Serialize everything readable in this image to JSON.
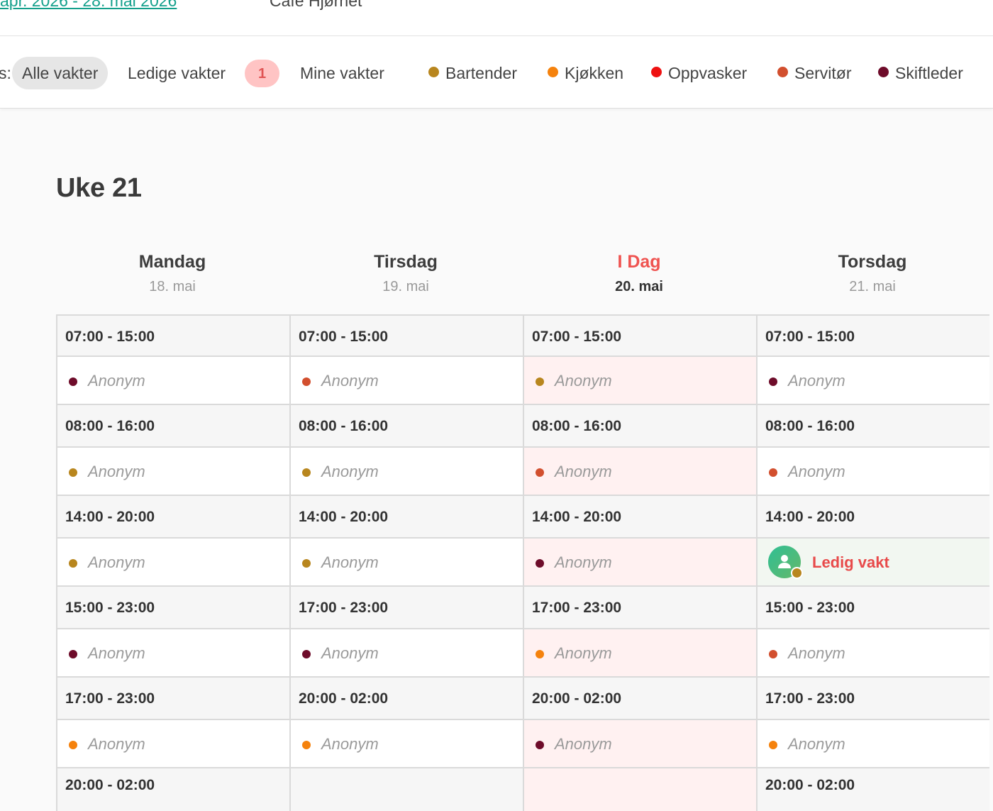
{
  "header": {
    "period_link": "apr. 2026 - 28. mai 2026",
    "location": "Café Hjørnet"
  },
  "filters": {
    "prefix": "s:",
    "tabs": [
      {
        "label": "Alle vakter",
        "active": true
      },
      {
        "label": "Ledige vakter",
        "badge": "1"
      },
      {
        "label": "Mine vakter"
      }
    ],
    "roles": [
      {
        "label": "Bartender",
        "color": "#b8861e"
      },
      {
        "label": "Kjøkken",
        "color": "#f5820d"
      },
      {
        "label": "Oppvasker",
        "color": "#ee1111"
      },
      {
        "label": "Servitør",
        "color": "#d24f2e"
      },
      {
        "label": "Skiftleder",
        "color": "#6e0c2a"
      }
    ]
  },
  "week": {
    "title": "Uke 21",
    "days": [
      {
        "name": "Mandag",
        "date": "18. mai",
        "today": false
      },
      {
        "name": "Tirsdag",
        "date": "19. mai",
        "today": false
      },
      {
        "name": "I Dag",
        "date": "20. mai",
        "today": true
      },
      {
        "name": "Torsdag",
        "date": "21. mai",
        "today": false
      }
    ]
  },
  "shifts": [
    [
      {
        "time": "07:00 - 15:00",
        "employee": "Anonym",
        "role_color": "#6e0c2a"
      },
      {
        "time": "08:00 - 16:00",
        "employee": "Anonym",
        "role_color": "#b8861e"
      },
      {
        "time": "14:00 - 20:00",
        "employee": "Anonym",
        "role_color": "#b8861e"
      },
      {
        "time": "15:00 - 23:00",
        "employee": "Anonym",
        "role_color": "#6e0c2a"
      },
      {
        "time": "17:00 - 23:00",
        "employee": "Anonym",
        "role_color": "#f5820d"
      },
      {
        "time": "20:00 - 02:00"
      }
    ],
    [
      {
        "time": "07:00 - 15:00",
        "employee": "Anonym",
        "role_color": "#d24f2e"
      },
      {
        "time": "08:00 - 16:00",
        "employee": "Anonym",
        "role_color": "#b8861e"
      },
      {
        "time": "14:00 - 20:00",
        "employee": "Anonym",
        "role_color": "#b8861e"
      },
      {
        "time": "17:00 - 23:00",
        "employee": "Anonym",
        "role_color": "#6e0c2a"
      },
      {
        "time": "20:00 - 02:00",
        "employee": "Anonym",
        "role_color": "#f5820d"
      },
      {
        "time": ""
      }
    ],
    [
      {
        "time": "07:00 - 15:00",
        "employee": "Anonym",
        "role_color": "#b8861e"
      },
      {
        "time": "08:00 - 16:00",
        "employee": "Anonym",
        "role_color": "#d24f2e"
      },
      {
        "time": "14:00 - 20:00",
        "employee": "Anonym",
        "role_color": "#6e0c2a"
      },
      {
        "time": "17:00 - 23:00",
        "employee": "Anonym",
        "role_color": "#f5820d"
      },
      {
        "time": "20:00 - 02:00",
        "employee": "Anonym",
        "role_color": "#6e0c2a"
      },
      {
        "time": ""
      }
    ],
    [
      {
        "time": "07:00 - 15:00",
        "employee": "Anonym",
        "role_color": "#6e0c2a"
      },
      {
        "time": "08:00 - 16:00",
        "employee": "Anonym",
        "role_color": "#d24f2e"
      },
      {
        "time": "14:00 - 20:00",
        "open": true,
        "open_label": "Ledig vakt",
        "role_color": "#b8861e"
      },
      {
        "time": "15:00 - 23:00",
        "employee": "Anonym",
        "role_color": "#d24f2e"
      },
      {
        "time": "17:00 - 23:00",
        "employee": "Anonym",
        "role_color": "#f5820d"
      },
      {
        "time": "20:00 - 02:00"
      }
    ]
  ]
}
